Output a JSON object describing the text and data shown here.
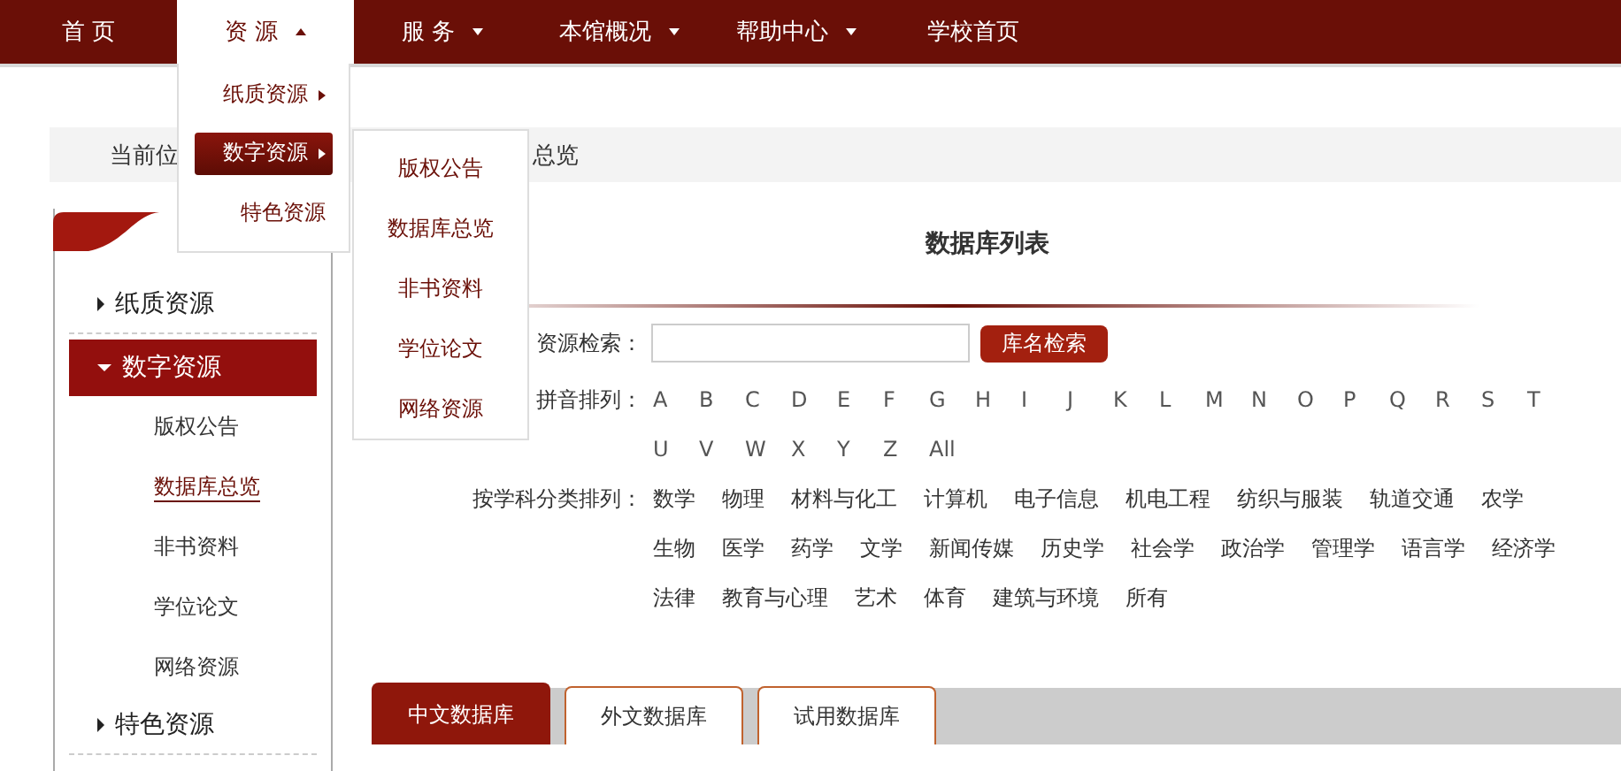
{
  "nav": [
    {
      "label": "首 页",
      "has_menu": false,
      "open": false
    },
    {
      "label": "资 源",
      "has_menu": true,
      "open": true
    },
    {
      "label": "服 务",
      "has_menu": true,
      "open": false
    },
    {
      "label": "本馆概况",
      "has_menu": true,
      "open": false
    },
    {
      "label": "帮助中心",
      "has_menu": true,
      "open": false
    },
    {
      "label": "学校首页",
      "has_menu": false,
      "open": false
    }
  ],
  "dropdown": {
    "items": [
      {
        "label": "纸质资源",
        "has_submenu": true,
        "selected": false
      },
      {
        "label": "数字资源",
        "has_submenu": true,
        "selected": true
      },
      {
        "label": "特色资源",
        "has_submenu": false,
        "selected": false
      }
    ],
    "submenu": [
      "版权公告",
      "数据库总览",
      "非书资料",
      "学位论文",
      "网络资源"
    ]
  },
  "breadcrumb": {
    "visible_start": "当前位",
    "visible_end": "总览"
  },
  "sidebar": {
    "items": [
      {
        "label": "纸质资源",
        "expanded": false
      },
      {
        "label": "数字资源",
        "expanded": true,
        "children": [
          {
            "label": "版权公告",
            "selected": false
          },
          {
            "label": "数据库总览",
            "selected": true
          },
          {
            "label": "非书资料",
            "selected": false
          },
          {
            "label": "学位论文",
            "selected": false
          },
          {
            "label": "网络资源",
            "selected": false
          }
        ]
      },
      {
        "label": "特色资源",
        "expanded": false
      }
    ]
  },
  "main": {
    "title": "数据库列表",
    "search": {
      "label": "资源检索：",
      "button": "库名检索"
    },
    "pinyin": {
      "label": "拼音排列：",
      "letters": [
        "A",
        "B",
        "C",
        "D",
        "E",
        "F",
        "G",
        "H",
        "I",
        "J",
        "K",
        "L",
        "M",
        "N",
        "O",
        "P",
        "Q",
        "R",
        "S",
        "T",
        "U",
        "V",
        "W",
        "X",
        "Y",
        "Z",
        "All"
      ]
    },
    "subjects": {
      "label": "按学科分类排列：",
      "items": [
        "数学",
        "物理",
        "材料与化工",
        "计算机",
        "电子信息",
        "机电工程",
        "纺织与服装",
        "轨道交通",
        "农学",
        "生物",
        "医学",
        "药学",
        "文学",
        "新闻传媒",
        "历史学",
        "社会学",
        "政治学",
        "管理学",
        "语言学",
        "经济学",
        "法律",
        "教育与心理",
        "艺术",
        "体育",
        "建筑与环境",
        "所有"
      ]
    },
    "tabs": [
      {
        "label": "中文数据库",
        "selected": true
      },
      {
        "label": "外文数据库",
        "selected": false
      },
      {
        "label": "试用数据库",
        "selected": false
      }
    ]
  }
}
